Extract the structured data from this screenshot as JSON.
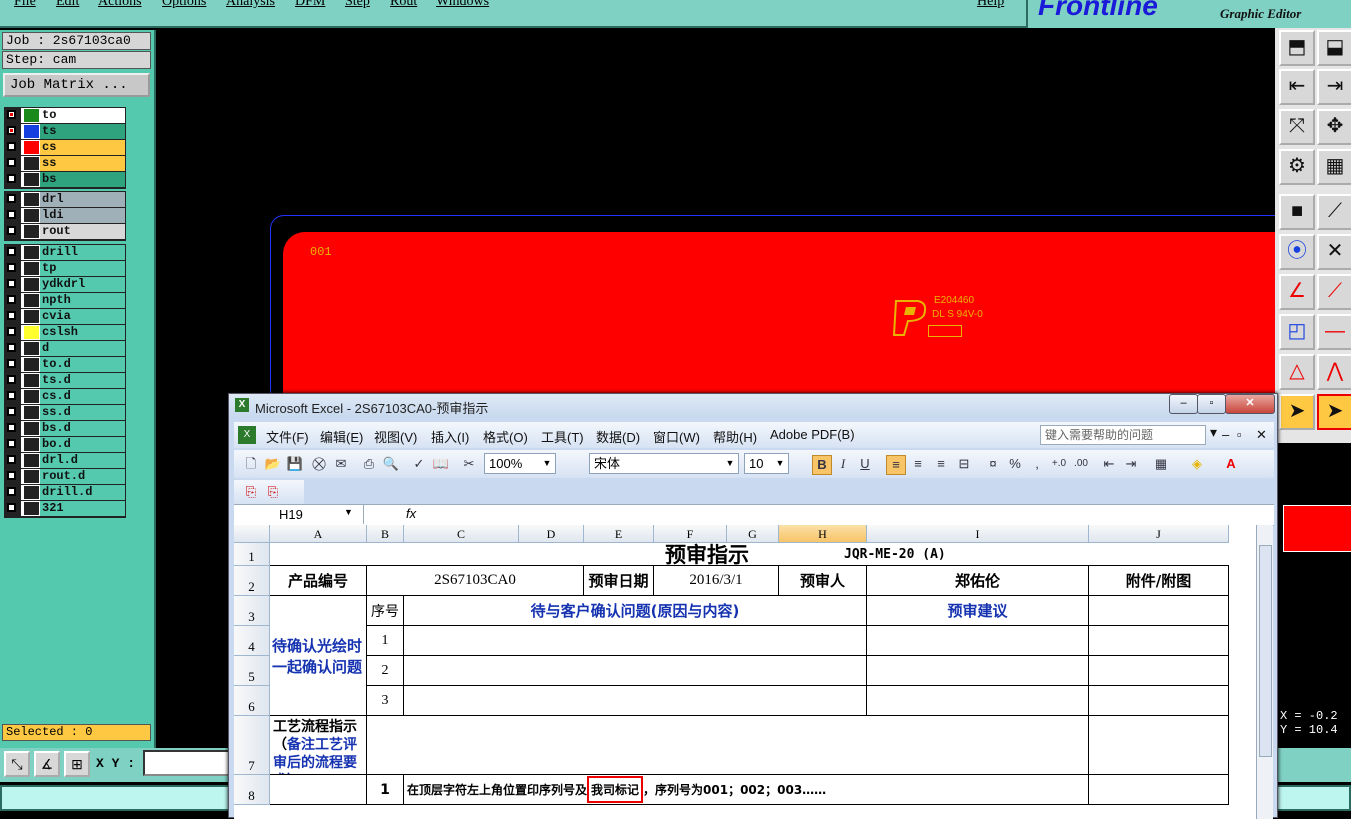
{
  "menu": {
    "items": [
      "File",
      "Edit",
      "Actions",
      "Options",
      "Analysis",
      "DFM",
      "Step",
      "Rout",
      "Windows"
    ],
    "help": "Help"
  },
  "logo": {
    "name": "Frontline",
    "subtitle": "Graphic Editor"
  },
  "left_panel": {
    "job": "Job : 2s67103ca0",
    "step": "Step: cam",
    "job_matrix": "Job Matrix ...",
    "layers_group1": [
      {
        "name": "to",
        "color": "#1a8a1a",
        "name_bg": "#ffffff",
        "checked": true
      },
      {
        "name": "ts",
        "color": "#1640e0",
        "name_bg": "#2ea37e",
        "checked": true
      },
      {
        "name": "cs",
        "color": "#ff0000",
        "name_bg": "#ffc843",
        "checked": false
      },
      {
        "name": "ss",
        "color": "#222222",
        "name_bg": "#ffc843",
        "checked": false
      },
      {
        "name": "bs",
        "color": "#222222",
        "name_bg": "#2ea37e",
        "checked": false
      }
    ],
    "layers_group2": [
      {
        "name": "drl",
        "color": "#222222",
        "name_bg": "#a0b0b8",
        "checked": false
      },
      {
        "name": "ldi",
        "color": "#222222",
        "name_bg": "#a0b0b8",
        "checked": false
      },
      {
        "name": "rout",
        "color": "#222222",
        "name_bg": "#d8d8d8",
        "checked": false
      }
    ],
    "layers_group3": [
      {
        "name": "drill",
        "color": "#222222",
        "name_bg": "#55c9ae",
        "checked": false
      },
      {
        "name": "tp",
        "color": "#222222",
        "name_bg": "#55c9ae",
        "checked": false
      },
      {
        "name": "ydkdrl",
        "color": "#222222",
        "name_bg": "#55c9ae",
        "checked": false
      },
      {
        "name": "npth",
        "color": "#222222",
        "name_bg": "#55c9ae",
        "checked": false
      },
      {
        "name": "cvia",
        "color": "#222222",
        "name_bg": "#55c9ae",
        "checked": false
      },
      {
        "name": "cslsh",
        "color": "#ffff30",
        "name_bg": "#55c9ae",
        "checked": false
      },
      {
        "name": "d",
        "color": "#222222",
        "name_bg": "#55c9ae",
        "checked": false
      },
      {
        "name": "to.d",
        "color": "#222222",
        "name_bg": "#55c9ae",
        "checked": false
      },
      {
        "name": "ts.d",
        "color": "#222222",
        "name_bg": "#55c9ae",
        "checked": false
      },
      {
        "name": "cs.d",
        "color": "#222222",
        "name_bg": "#55c9ae",
        "checked": false
      },
      {
        "name": "ss.d",
        "color": "#222222",
        "name_bg": "#55c9ae",
        "checked": false
      },
      {
        "name": "bs.d",
        "color": "#222222",
        "name_bg": "#55c9ae",
        "checked": false
      },
      {
        "name": "bo.d",
        "color": "#222222",
        "name_bg": "#55c9ae",
        "checked": false
      },
      {
        "name": "drl.d",
        "color": "#222222",
        "name_bg": "#55c9ae",
        "checked": false
      },
      {
        "name": "rout.d",
        "color": "#222222",
        "name_bg": "#55c9ae",
        "checked": false
      },
      {
        "name": "drill.d",
        "color": "#222222",
        "name_bg": "#55c9ae",
        "checked": false
      },
      {
        "name": "321",
        "color": "#222222",
        "name_bg": "#55c9ae",
        "checked": false
      }
    ],
    "selected": "Selected : 0"
  },
  "canvas": {
    "board_color": "#ff0000",
    "board_number": "001",
    "ul_mark_line1": "E204460",
    "ul_mark_line2": "DL S 94V-0"
  },
  "coords": {
    "x": "X = -0.2",
    "y": "Y = 10.4"
  },
  "bottom": {
    "xy_label": "X Y :",
    "xy_value": ""
  },
  "excel": {
    "title": "Microsoft Excel - 2S67103CA0-预审指示",
    "menu": [
      "文件(F)",
      "编辑(E)",
      "视图(V)",
      "插入(I)",
      "格式(O)",
      "工具(T)",
      "数据(D)",
      "窗口(W)",
      "帮助(H)",
      "Adobe PDF(B)"
    ],
    "help_placeholder": "键入需要帮助的问题",
    "zoom": "100%",
    "font": "宋体",
    "font_size": "10",
    "name_box": "H19",
    "fx": "fx",
    "columns": [
      "A",
      "B",
      "C",
      "D",
      "E",
      "F",
      "G",
      "H",
      "I",
      "J"
    ],
    "selected_column": "H",
    "rows": [
      "1",
      "2",
      "3",
      "4",
      "5",
      "6",
      "7",
      "8"
    ],
    "sheet": {
      "title": "预审指示",
      "doc_code": "JQR-ME-20 (A)",
      "product_no_label": "产品编号",
      "product_no": "2S67103CA0",
      "review_date_label": "预审日期",
      "review_date": "2016/3/1",
      "reviewer_label": "预审人",
      "reviewer": "郑佑伦",
      "attachment_label": "附件/附图",
      "seq_label": "序号",
      "issue_header": "待与客户确认问题(原因与内容)",
      "suggestion_header": "预审建议",
      "confirm_label": "待确认光绘时一起确认问题",
      "seq_items": [
        "1",
        "2",
        "3"
      ],
      "process_label_black": "工艺流程指示（",
      "process_label_blue": "备注工艺评审后的流程要求）",
      "row8_seq": "1",
      "row8_text_a": "在顶层字符左上角位置印序列号及",
      "row8_text_highlight": "我司标记",
      "row8_text_b": "，序列号为001；002；003……"
    }
  }
}
